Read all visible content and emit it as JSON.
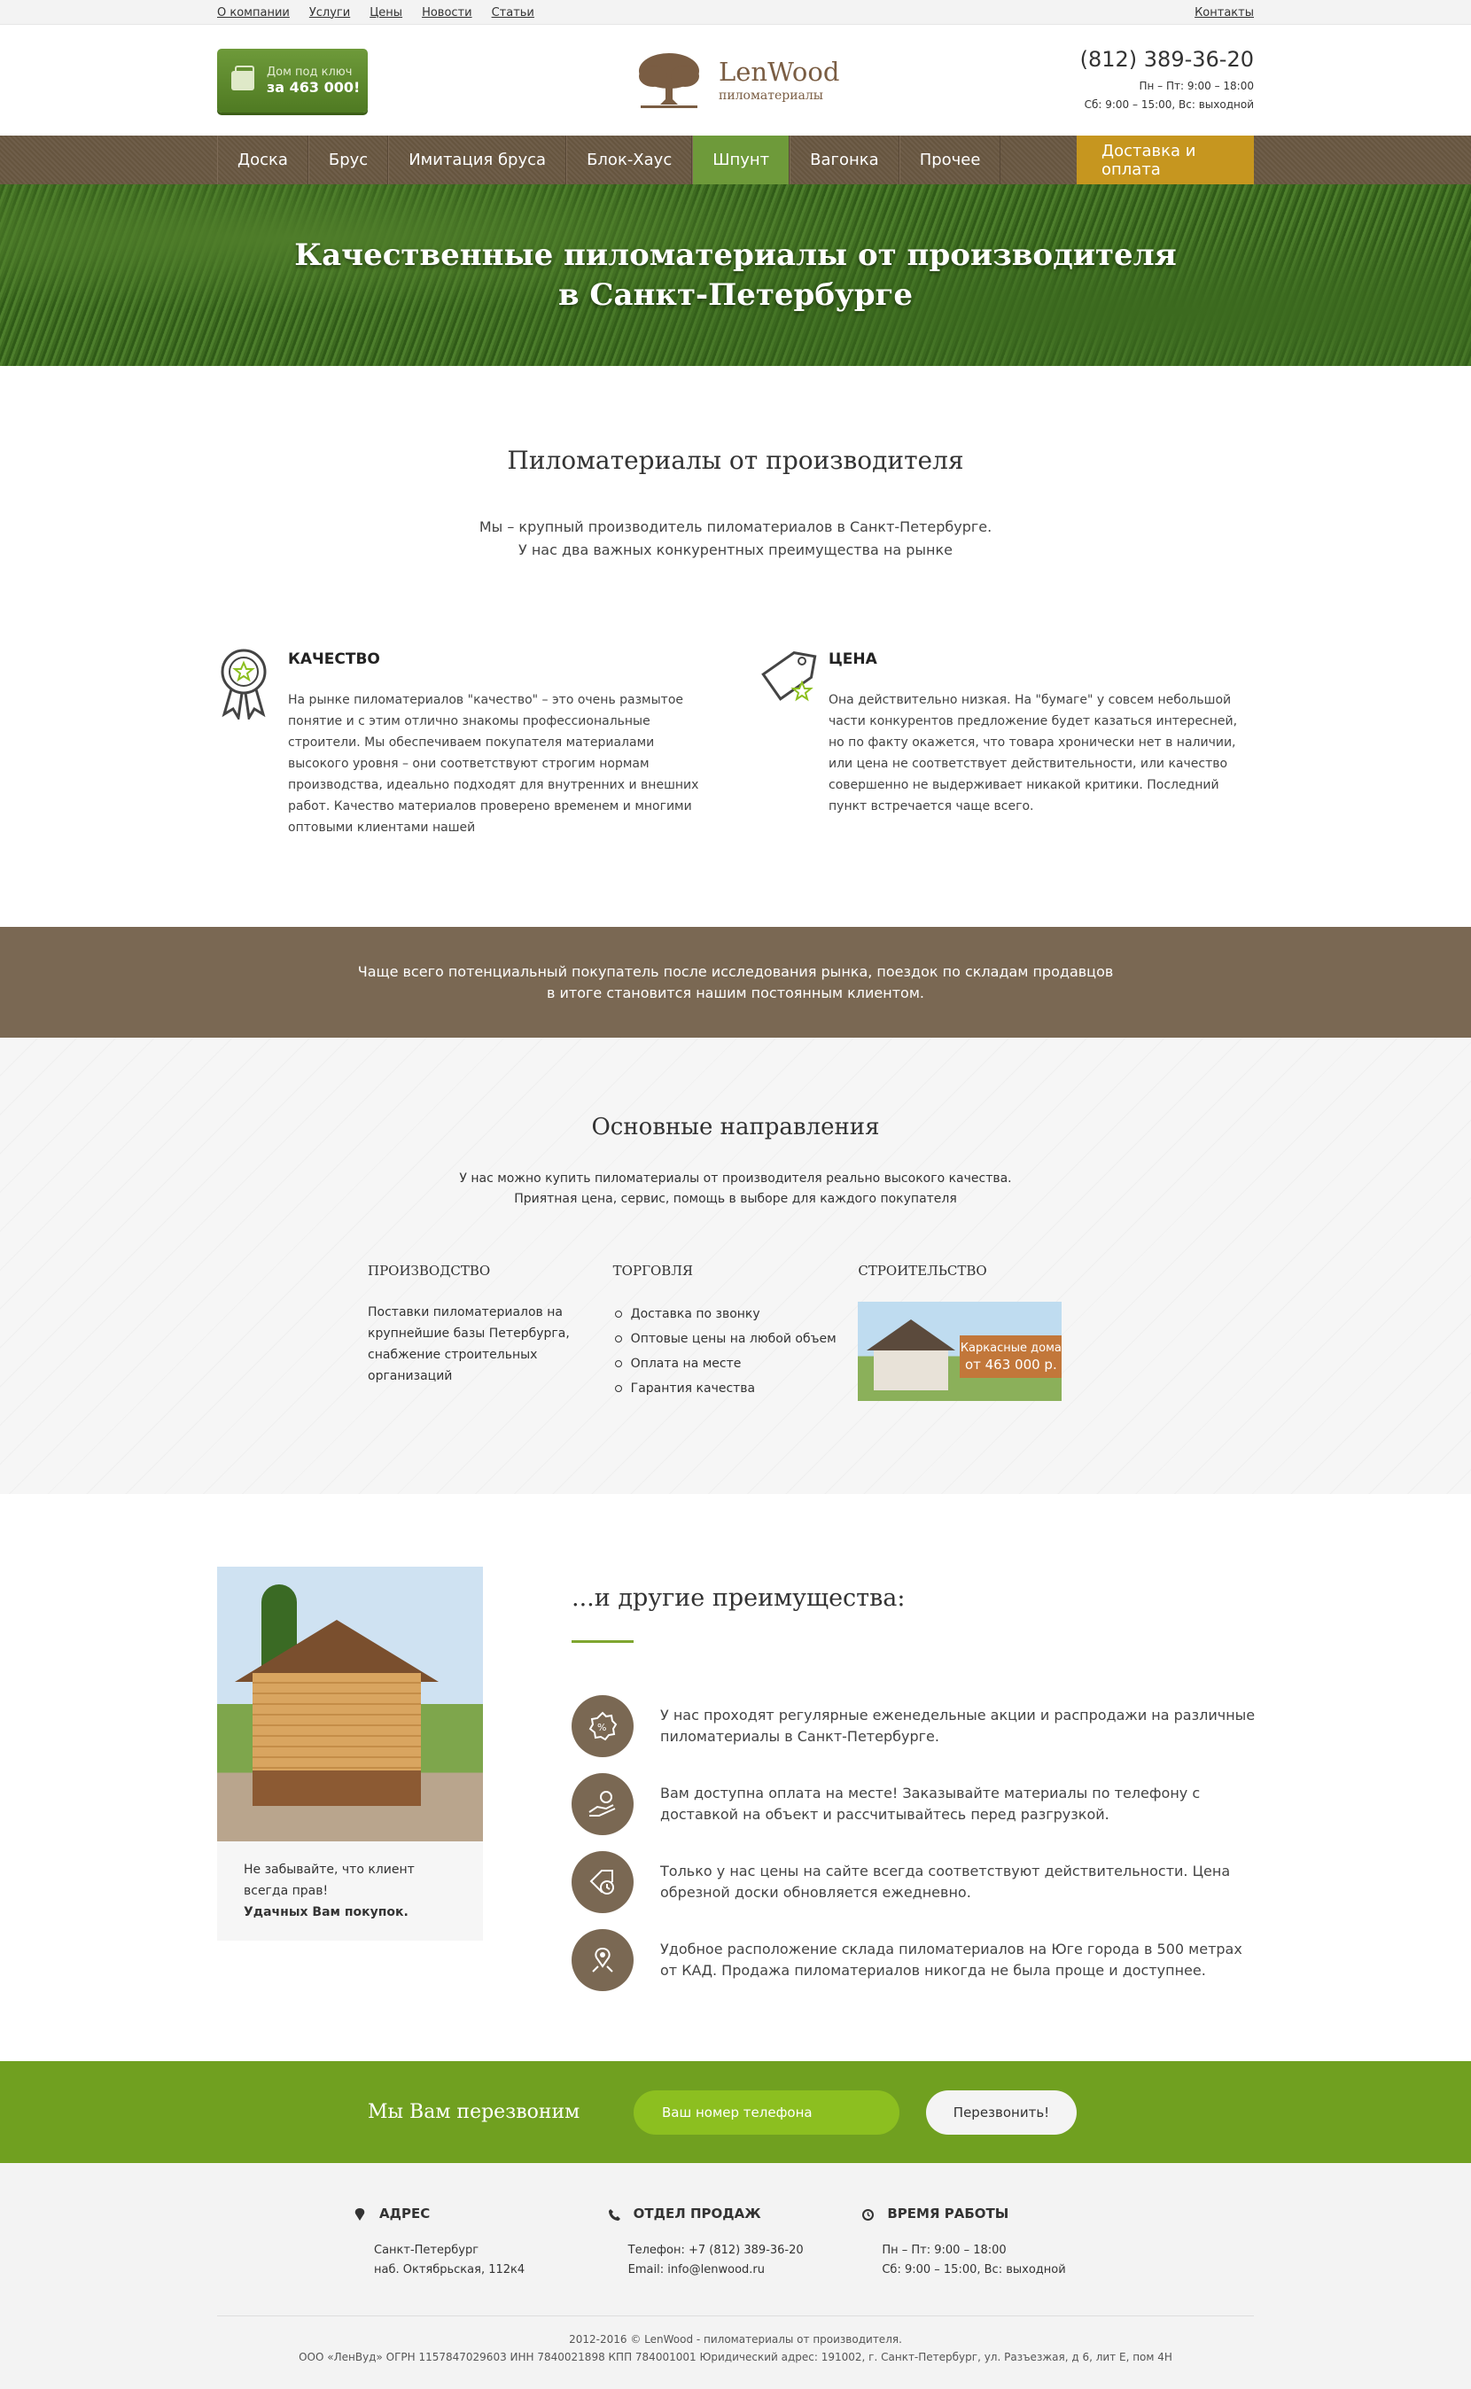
{
  "topbar": {
    "links": [
      "О компании",
      "Услуги",
      "Цены",
      "Новости",
      "Статьи"
    ],
    "right_link": "Контакты"
  },
  "header": {
    "promo_line1": "Дом под ключ",
    "promo_line2": "за 463 000!",
    "logo_name": "LenWood",
    "logo_sub": "пиломатериалы",
    "phone": "(812) 389-36-20",
    "hours1": "Пн – Пт: 9:00 – 18:00",
    "hours2": "Сб: 9:00 – 15:00, Вс: выходной"
  },
  "nav": {
    "items": [
      "Доска",
      "Брус",
      "Имитация бруса",
      "Блок-Хаус",
      "Шпунт",
      "Вагонка",
      "Прочее"
    ],
    "active": "Шпунт",
    "delivery": "Доставка и оплата"
  },
  "hero": {
    "line1": "Качественные пиломатериалы от производителя",
    "line2": "в Санкт-Петербурге"
  },
  "intro": {
    "title": "Пиломатериалы от производителя",
    "line1": "Мы – крупный производитель пиломатериалов в Санкт-Петербурге.",
    "line2": "У нас два важных конкурентных преимущества на рынке"
  },
  "features": {
    "quality": {
      "title": "КАЧЕСТВО",
      "text": "На рынке пиломатериалов \"качество\" – это очень размытое понятие и с этим отлично знакомы профессиональные строители. Мы обеспечиваем покупателя материалами высокого уровня – они соответствуют строгим нормам производства, идеально подходят для внутренних и внешних работ. Качество материалов проверено временем и многими оптовыми клиентами нашей"
    },
    "price": {
      "title": "ЦЕНА",
      "text": "Она действительно низкая. На \"бумаге\" у совсем небольшой части конкурентов предложение будет казаться интересней, но по факту окажется, что товара хронически нет в наличии, или цена не соответствует действительности, или качество совершенно не выдерживает никакой критики. Последний пункт встречается чаще всего."
    }
  },
  "band": {
    "line1": "Чаще всего потенциальный покупатель после исследования рынка, поездок по складам продавцов",
    "line2": "в итоге становится нашим постоянным клиентом."
  },
  "directions": {
    "title": "Основные направления",
    "lead1": "У нас можно купить пиломатериалы от производителя реально высокого качества.",
    "lead2": "Приятная цена, сервис, помощь в выборе для каждого покупателя",
    "production_title": "ПРОИЗВОДСТВО",
    "production_text": "Поставки пиломатериалов на крупнейшие базы Петербурга, снабжение строительных организаций",
    "trade_title": "ТОРГОВЛЯ",
    "trade_items": [
      "Доставка по звонку",
      "Оптовые цены на любой объем",
      "Оплата на месте",
      "Гарантия качества"
    ],
    "build_title": "СТРОИТЕЛЬСТВО",
    "build_tag1": "Каркасные дома",
    "build_tag2": "от 463 000 р."
  },
  "advantages": {
    "note1": "Не забывайте, что клиент всегда прав!",
    "note2": "Удачных Вам покупок.",
    "title": "...и другие преимущества:",
    "items": [
      {
        "text": "У нас проходят регулярные еженедельные акции и распродажи на различные пиломатериалы в Санкт-Петербурге.",
        "icon": "discount-icon"
      },
      {
        "text": "Вам доступна оплата на месте! Заказывайте материалы по телефону с доставкой на объект и рассчитывайтесь перед разгрузкой.",
        "icon": "hand-coin-icon"
      },
      {
        "text": "Только у нас цены на сайте всегда соответствуют действительности. Цена обрезной доски обновляется ежедневно.",
        "icon": "price-tag-clock-icon"
      },
      {
        "text": "Удобное расположение склада пиломатериалов на Юге города в 500 метрах от КАД. Продажа пиломатериалов никогда не была проще и доступнее.",
        "icon": "location-icon"
      }
    ]
  },
  "callback": {
    "title": "Мы Вам перезвоним",
    "placeholder": "Ваш номер телефона",
    "button": "Перезвонить!"
  },
  "footer": {
    "address_title": "АДРЕС",
    "address1": "Санкт-Петербург",
    "address2": "наб. Октябрьская, 112к4",
    "sales_title": "ОТДЕЛ ПРОДАЖ",
    "sales1": "Телефон: +7 (812) 389-36-20",
    "sales2": "Email: info@lenwood.ru",
    "hours_title": "ВРЕМЯ РАБОТЫ",
    "hours1": "Пн – Пт: 9:00 – 18:00",
    "hours2": "Сб: 9:00 – 15:00, Вс: выходной",
    "copy1": "2012-2016 © LenWood - пиломатериалы от производителя.",
    "copy2": "ООО «ЛенВуд» ОГРН 1157847029603 ИНН 7840021898 КПП 784001001 Юридический адрес: 191002, г. Санкт-Петербург, ул. Разъезжая, д 6, лит Е, пом 4Н"
  },
  "colors": {
    "green": "#70a020",
    "brown": "#7a6853",
    "gold": "#c6961f"
  }
}
